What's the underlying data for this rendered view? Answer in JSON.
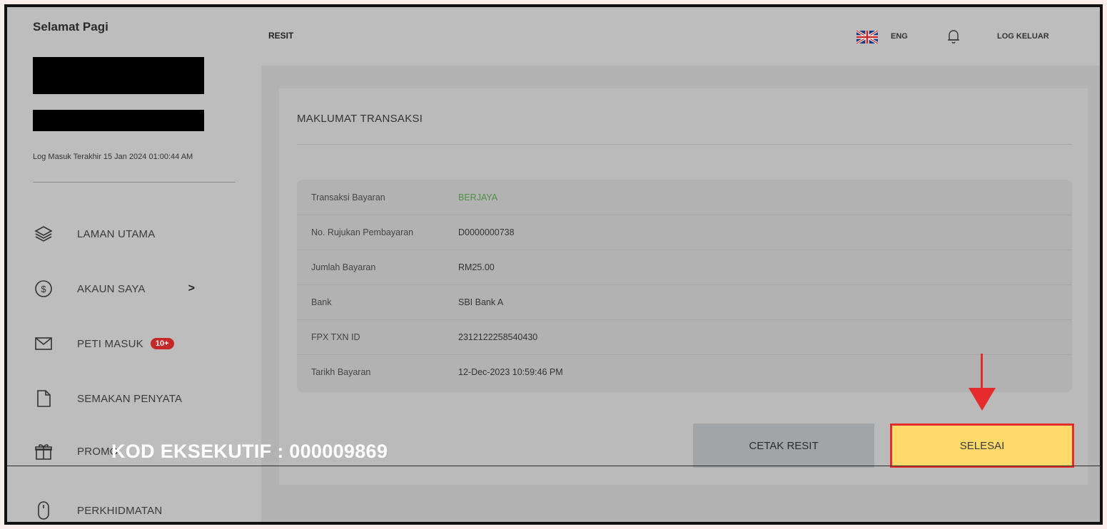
{
  "sidebar": {
    "greeting": "Selamat Pagi",
    "last_login": "Log Masuk Terakhir 15 Jan 2024 01:00:44 AM",
    "items": [
      {
        "label": "LAMAN UTAMA",
        "icon": "layers-icon"
      },
      {
        "label": "AKAUN SAYA",
        "icon": "dollar-circle-icon",
        "chevron": ">"
      },
      {
        "label": "PETI MASUK",
        "icon": "mail-icon",
        "badge": "10+"
      },
      {
        "label": "SEMAKAN PENYATA",
        "icon": "document-icon"
      },
      {
        "label": "PROMO",
        "icon": "gift-icon"
      },
      {
        "label": "PERKHIDMATAN",
        "icon": "mouse-icon"
      }
    ]
  },
  "header": {
    "title": "RESIT",
    "language": "ENG",
    "logout": "LOG KELUAR"
  },
  "transaction": {
    "title": "MAKLUMAT TRANSAKSI",
    "rows": [
      {
        "label": "Transaksi Bayaran",
        "value": "BERJAYA"
      },
      {
        "label": "No. Rujukan Pembayaran",
        "value": "D0000000738"
      },
      {
        "label": "Jumlah Bayaran",
        "value": "RM25.00"
      },
      {
        "label": "Bank",
        "value": "SBI Bank A"
      },
      {
        "label": "FPX TXN ID",
        "value": "2312122258540430"
      },
      {
        "label": "Tarikh Bayaran",
        "value": "12-Dec-2023 10:59:46 PM"
      }
    ]
  },
  "actions": {
    "print_label": "CETAK RESIT",
    "done_label": "SELESAI"
  },
  "watermark": "KOD EKSEKUTIF : 000009869",
  "colors": {
    "highlight": "#e52b2b",
    "done_button": "#ffd969",
    "success_text": "#4e8f43",
    "badge": "#c62828"
  }
}
